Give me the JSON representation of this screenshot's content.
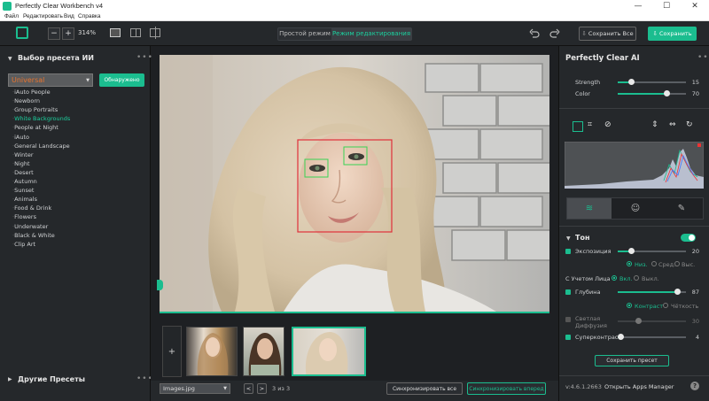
{
  "window": {
    "title": "Perfectly Clear Workbench v4",
    "minimize": "—",
    "maximize": "☐",
    "close": "✕"
  },
  "menu": [
    "Файл",
    "Редактировать",
    "Вид",
    "Справка"
  ],
  "toolbar": {
    "zoom_minus": "−",
    "zoom_plus": "+",
    "zoom_level": "314%",
    "mode_simple": "Простой режим",
    "mode_edit": "Режим редактирования",
    "save_all": "Сохранить Все",
    "save": "Сохранить",
    "undo_icon": "undo-icon",
    "redo_icon": "redo-icon"
  },
  "left": {
    "ai_title": "Выбор пресета ИИ",
    "preset_select": "Universal",
    "detected_btn": "Обнаружено",
    "presets": [
      "iAuto People",
      "Newborn",
      "Group Portraits",
      "White Backgrounds",
      "People at Night",
      "iAuto",
      "General Landscape",
      "Winter",
      "Night",
      "Desert",
      "Autumn",
      "Sunset",
      "Animals",
      "Food & Drink",
      "Flowers",
      "Underwater",
      "Black & White",
      "Clip Art"
    ],
    "selected_preset": "White Backgrounds",
    "other_title": "Другие Пресеты",
    "dots": "•••"
  },
  "bottom": {
    "file_select": "Images.jpg",
    "prev": "<",
    "next": ">",
    "counter": "3 из 3",
    "sync_all": "Синхронизировать все",
    "sync_forward": "Синхронизировать вперед"
  },
  "right": {
    "ai_title": "Perfectly Clear AI",
    "strength_label": "Strength",
    "strength_value": "15",
    "strength_level": 0.2,
    "color_label": "Color",
    "color_value": "70",
    "color_level": 0.72,
    "tone_title": "Тон",
    "exposure_label": "Экспозиция",
    "exposure_value": "20",
    "exposure_level": 0.2,
    "exposure_opts": [
      "Низ.",
      "Сред.",
      "Выс."
    ],
    "face_label": "С Учетом Лица",
    "face_opts": [
      "Вкл.",
      "Выкл."
    ],
    "depth_label": "Глубина",
    "depth_value": "87",
    "depth_level": 0.87,
    "depth_opts": [
      "Контраст",
      "Чёткость"
    ],
    "diffusion_label": "Светлая Диффузия",
    "diffusion_value": "30",
    "diffusion_level": 0.3,
    "supercontrast_label": "Суперконтраст",
    "supercontrast_value": "4",
    "supercontrast_level": 0.04,
    "save_preset": "Сохранить пресет",
    "version": "v:4.6.1.2663",
    "apps_manager": "Открыть Apps Manager",
    "help": "?"
  },
  "colors": {
    "accent": "#1bbd8f",
    "panel": "#25282b",
    "bg": "#1e2023",
    "face_box": "#e0303a",
    "eye_box": "#39d353"
  }
}
